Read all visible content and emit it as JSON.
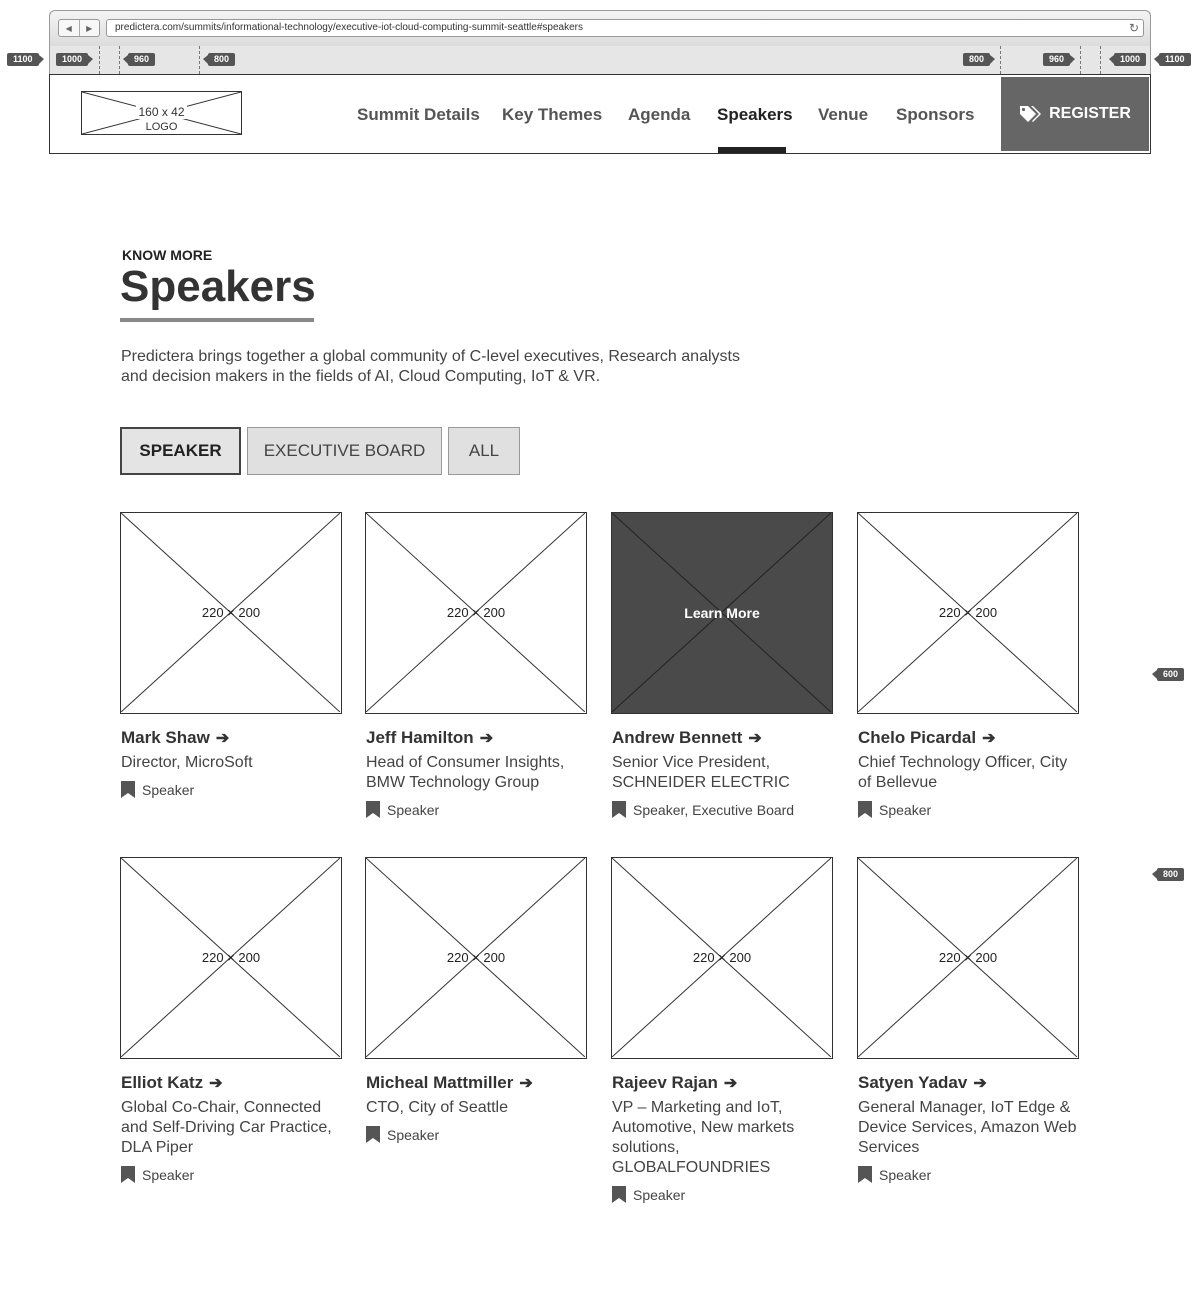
{
  "browser": {
    "url": "predictera.com/summits/informational-technology/executive-iot-cloud-computing-summit-seattle#speakers"
  },
  "ruler": {
    "left": [
      "1100",
      "1000",
      "960",
      "800"
    ],
    "right": [
      "800",
      "960",
      "1000",
      "1100"
    ],
    "side": [
      "600",
      "800"
    ]
  },
  "header": {
    "logo_size": "160 x 42",
    "logo_label": "LOGO",
    "nav": [
      "Summit Details",
      "Key Themes",
      "Agenda",
      "Speakers",
      "Venue",
      "Sponsors"
    ],
    "active_nav": "Speakers",
    "register_label": "REGISTER"
  },
  "section": {
    "eyebrow": "KNOW MORE",
    "title": "Speakers",
    "description": "Predictera brings together a global community of C-level executives, Research analysts and decision makers in the fields of AI, Cloud Computing, IoT & VR."
  },
  "filters": [
    {
      "label": "SPEAKER",
      "active": true
    },
    {
      "label": "EXECUTIVE BOARD",
      "active": false
    },
    {
      "label": "ALL",
      "active": false
    }
  ],
  "image_placeholder": "220 × 200",
  "hover_label": "Learn More",
  "speakers": [
    {
      "name": "Mark Shaw",
      "role": "Director, MicroSoft",
      "tag": "Speaker"
    },
    {
      "name": "Jeff Hamilton",
      "role": "Head of Consumer Insights, BMW Technology Group",
      "tag": "Speaker"
    },
    {
      "name": "Andrew Bennett",
      "role": "Senior Vice President, SCHNEIDER ELECTRIC",
      "tag": "Speaker, Executive Board",
      "hovered": true
    },
    {
      "name": "Chelo Picardal",
      "role": "Chief Technology Officer, City of Bellevue",
      "tag": "Speaker"
    },
    {
      "name": "Elliot Katz",
      "role": "Global Co-Chair, Connected and Self-Driving Car Practice, DLA Piper",
      "tag": "Speaker"
    },
    {
      "name": "Micheal Mattmiller",
      "role": "CTO, City of Seattle",
      "tag": "Speaker"
    },
    {
      "name": "Rajeev Rajan",
      "role": "VP – Marketing and IoT, Automotive, New markets solutions, GLOBALFOUNDRIES",
      "tag": "Speaker"
    },
    {
      "name": "Satyen Yadav",
      "role": "General Manager, IoT Edge & Device Services, Amazon Web Services",
      "tag": "Speaker"
    }
  ],
  "icons": {
    "arrow": "arrow-right-icon",
    "bookmark": "bookmark-icon",
    "register": "tags-icon"
  }
}
